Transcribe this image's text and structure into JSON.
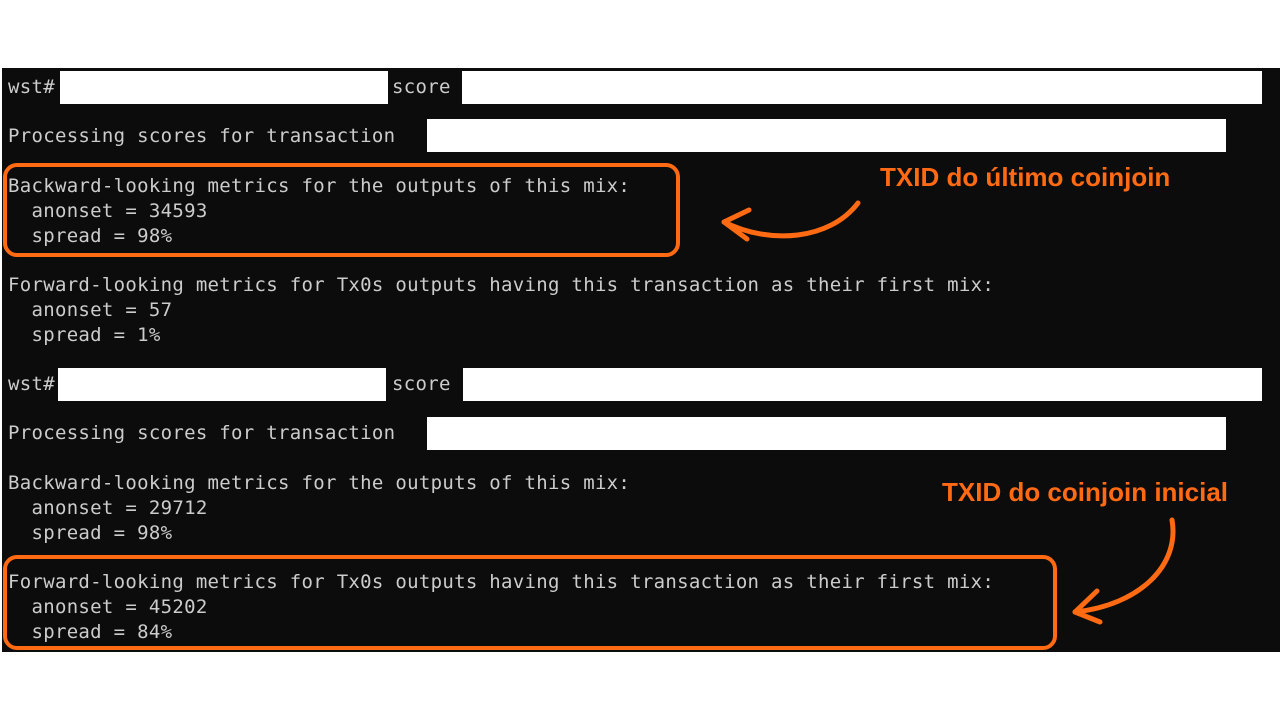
{
  "terminal": {
    "block1": {
      "prompt": "wst#",
      "score_label": "score",
      "processing": "Processing scores for transaction",
      "backward_header": "Backward-looking metrics for the outputs of this mix:",
      "backward_anonset": "  anonset = 34593",
      "backward_spread": "  spread = 98%",
      "forward_header": "Forward-looking metrics for Tx0s outputs having this transaction as their first mix:",
      "forward_anonset": "  anonset = 57",
      "forward_spread": "  spread = 1%"
    },
    "block2": {
      "prompt": "wst#",
      "score_label": "score",
      "processing": "Processing scores for transaction",
      "backward_header": "Backward-looking metrics for the outputs of this mix:",
      "backward_anonset": "  anonset = 29712",
      "backward_spread": "  spread = 98%",
      "forward_header": "Forward-looking metrics for Tx0s outputs having this transaction as their first mix:",
      "forward_anonset": "  anonset = 45202",
      "forward_spread": "  spread = 84%"
    }
  },
  "annotations": {
    "last_coinjoin": "TXID do último coinjoin",
    "initial_coinjoin": "TXID do coinjoin inicial",
    "color": "#ff6a13"
  }
}
